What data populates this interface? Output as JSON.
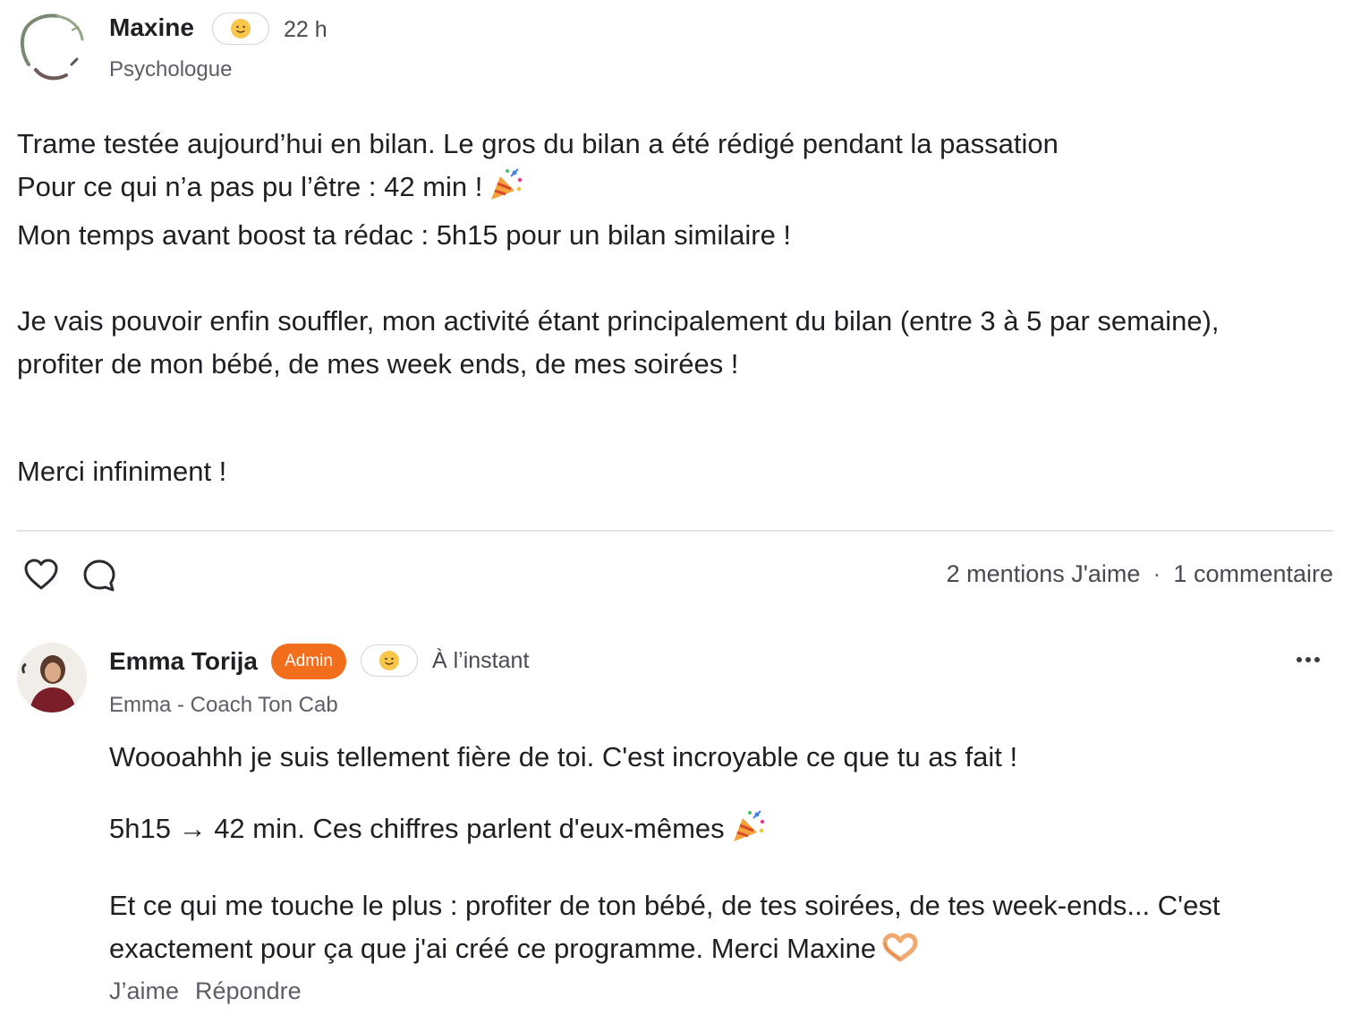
{
  "post": {
    "author": {
      "name": "Maxine",
      "role": "Psychologue",
      "time": "22 h",
      "flair_icon": "smiling-face-icon"
    },
    "body": {
      "line1": "Trame testée aujourd’hui en bilan. Le gros du bilan a été rédigé pendant la passation",
      "line2": "Pour ce qui n’a pas pu l’être : 42 min !",
      "line2_emoji": "party-popper-icon",
      "line3": "Mon temps avant boost ta rédac : 5h15 pour un bilan similaire !",
      "paragraph2": "Je vais pouvoir enfin souffler, mon activité étant principalement du bilan (entre 3 à 5 par semaine), profiter de mon bébé, de mes week ends, de mes soirées !",
      "paragraph3": "Merci infiniment !"
    },
    "actions": {
      "like_icon": "heart-icon",
      "comment_icon": "comment-bubble-icon"
    },
    "stats": {
      "likes": "2 mentions J'aime",
      "separator": "·",
      "comments": "1 commentaire"
    }
  },
  "comment": {
    "author": {
      "name": "Emma Torija",
      "badge": "Admin",
      "role": "Emma - Coach Ton Cab",
      "time": "À l’instant",
      "flair_icon": "smiling-face-icon"
    },
    "body": {
      "paragraph1": "Woooahhh je suis tellement fière de toi. C'est incroyable ce que tu as fait !",
      "paragraph2": "5h15 → 42 min. Ces chiffres parlent d'eux-mêmes",
      "paragraph2_emoji": "party-popper-icon",
      "paragraph3": "Et ce qui me touche le plus : profiter de ton bébé, de tes soirées, de tes week-ends... C'est exactement pour ça que j'ai créé ce programme. Merci Maxine",
      "paragraph3_emoji": "heart-hands-icon"
    },
    "actions": {
      "like": "J’aime",
      "reply": "Répondre",
      "more_icon": "more-horizontal-icon"
    }
  },
  "colors": {
    "admin_badge": "#f26d1c",
    "divider": "#e4e4e8",
    "text": "#1f1f24",
    "muted": "#5d5d66"
  }
}
